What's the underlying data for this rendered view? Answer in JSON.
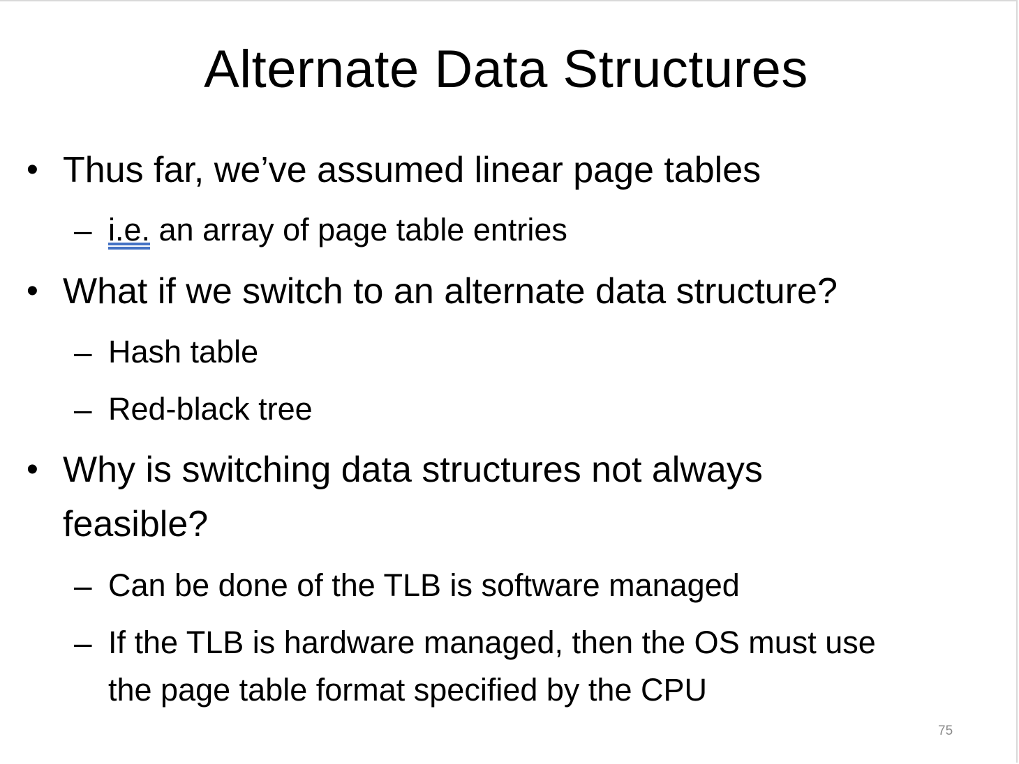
{
  "slide": {
    "title": "Alternate Data Structures",
    "bullet_symbol": "•",
    "dash_symbol": "–",
    "bullets": [
      {
        "text": "Thus far, we’ve assumed linear page tables",
        "sub": [
          {
            "link_text": "i.e.",
            "text": " an array of page table entries"
          }
        ]
      },
      {
        "text": "What if we switch to an alternate data structure?",
        "sub": [
          {
            "text": "Hash table"
          },
          {
            "text": "Red-black tree"
          }
        ]
      },
      {
        "text_line1": "Why is switching data structures not always",
        "text_line2": "feasible?",
        "sub": [
          {
            "text": "Can be done of the TLB is software managed"
          },
          {
            "text_line1": "If the TLB is hardware managed, then the OS must use",
            "text_line2": "the page table format specified by the CPU"
          }
        ]
      }
    ],
    "page_number": "75"
  }
}
